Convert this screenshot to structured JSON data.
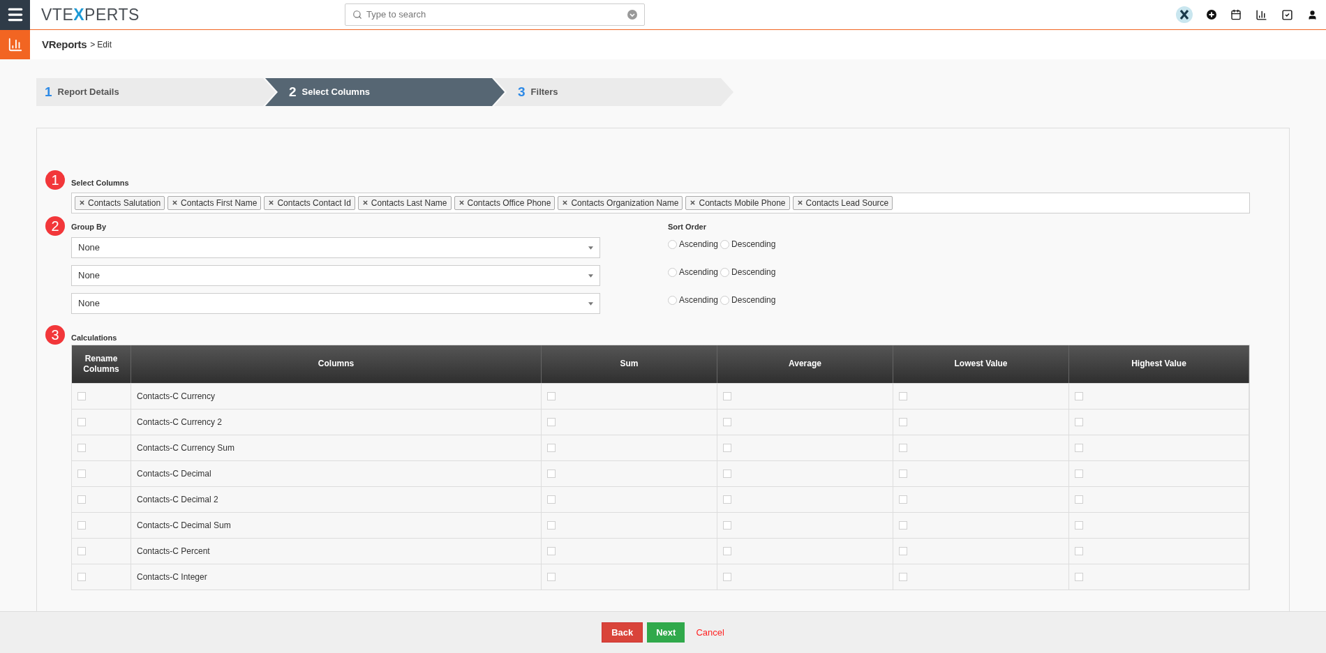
{
  "header": {
    "logo": [
      {
        "text": "VTE",
        "accent": false
      },
      {
        "text": "X",
        "accent": true
      },
      {
        "text": "PERTS",
        "accent": false
      }
    ],
    "search": {
      "placeholder": "Type to search"
    }
  },
  "breadcrumb": {
    "module": "VReports",
    "separator": ">",
    "page": "Edit"
  },
  "steps": [
    {
      "number": "1",
      "label": "Report Details",
      "selected": false
    },
    {
      "number": "2",
      "label": "Select Columns",
      "selected": true
    },
    {
      "number": "3",
      "label": "Filters",
      "selected": false
    }
  ],
  "select_columns": {
    "marker": "1",
    "label": "Select Columns",
    "tags": [
      "Contacts Salutation",
      "Contacts First Name",
      "Contacts Contact Id",
      "Contacts Last Name",
      "Contacts Office Phone",
      "Contacts Organization Name",
      "Contacts Mobile Phone",
      "Contacts Lead Source"
    ]
  },
  "group_by": {
    "marker": "2",
    "label": "Group By",
    "selects": [
      "None",
      "None",
      "None"
    ]
  },
  "sort_order": {
    "label": "Sort Order",
    "rows": [
      [
        {
          "label": "Ascending",
          "selected": false
        },
        {
          "label": "Descending",
          "selected": false
        }
      ],
      [
        {
          "label": "Ascending",
          "selected": false
        },
        {
          "label": "Descending",
          "selected": false
        }
      ],
      [
        {
          "label": "Ascending",
          "selected": false
        },
        {
          "label": "Descending",
          "selected": false
        }
      ]
    ]
  },
  "calculations": {
    "marker": "3",
    "label": "Calculations",
    "columns": [
      "Rename Columns",
      "Columns",
      "Sum",
      "Average",
      "Lowest Value",
      "Highest Value"
    ],
    "rows": [
      {
        "name": "Contacts-C Currency",
        "rename": false,
        "checks": [
          false,
          false,
          false,
          false
        ]
      },
      {
        "name": "Contacts-C Currency 2",
        "rename": false,
        "checks": [
          false,
          false,
          false,
          false
        ]
      },
      {
        "name": "Contacts-C Currency Sum",
        "rename": false,
        "checks": [
          false,
          false,
          false,
          false
        ]
      },
      {
        "name": "Contacts-C Decimal",
        "rename": false,
        "checks": [
          false,
          false,
          false,
          false
        ]
      },
      {
        "name": "Contacts-C Decimal 2",
        "rename": false,
        "checks": [
          false,
          false,
          false,
          false
        ]
      },
      {
        "name": "Contacts-C Decimal Sum",
        "rename": false,
        "checks": [
          false,
          false,
          false,
          false
        ]
      },
      {
        "name": "Contacts-C Percent",
        "rename": false,
        "checks": [
          false,
          false,
          false,
          false
        ]
      },
      {
        "name": "Contacts-C Integer",
        "rename": false,
        "checks": [
          false,
          false,
          false,
          false
        ]
      }
    ]
  },
  "footer": {
    "back": "Back",
    "next": "Next",
    "cancel": "Cancel"
  }
}
